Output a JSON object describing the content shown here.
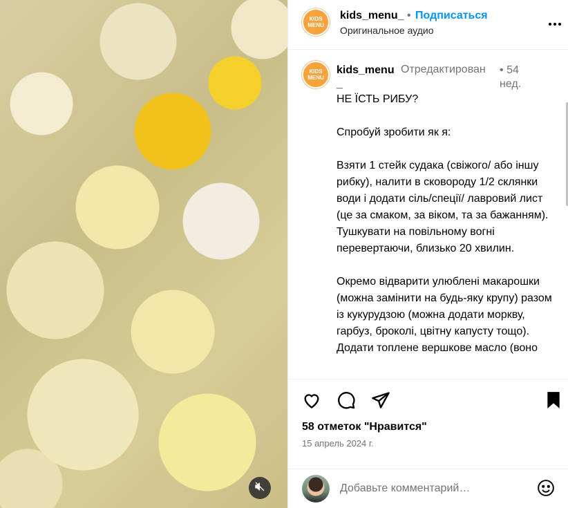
{
  "media": {
    "mute_icon": "speaker-muted-icon"
  },
  "header": {
    "username": "kids_menu_",
    "separator": "•",
    "follow_label": "Подписаться",
    "audio_label": "Оригинальное аудио",
    "avatar_text_line1": "KIDS",
    "avatar_text_line2": "MENU",
    "more_icon": "more-horizontal-icon",
    "accent_color": "#0095f6",
    "avatar_color": "#f7a23a"
  },
  "caption": {
    "username": "kids_menu_",
    "edited_label": "Отредактирован",
    "time_separator": "•",
    "time_ago": "54 нед.",
    "text": "НЕ ЇСТЬ РИБУ?\n\nСпробуй зробити як я:\n\nВзяти 1 стейк судака (свіжого/ або іншу рибку), налити в сковороду 1/2 склянки води і додати сіль/спеції/ лавровий лист (це за смаком, за віком, та за бажанням).\nТушкувати на повільному вогні перевертаючи, близько 20 хвилин.\n\nОкремо відварити улюблені макарошки (можна замінити на будь-яку крупу) разом із кукурудзою (можна додати моркву, гарбуз, броколі, цвітну капусту тощо). Додати топлене вершкове масло (воно"
  },
  "actions": {
    "like_icon": "heart-icon",
    "comment_icon": "comment-icon",
    "share_icon": "share-icon",
    "save_icon": "bookmark-icon",
    "likes_text": "58 отметок \"Нравится\"",
    "date_text": "15 апрель 2024 г."
  },
  "comment": {
    "placeholder": "Добавьте комментарий…",
    "emoji_icon": "emoji-icon"
  }
}
